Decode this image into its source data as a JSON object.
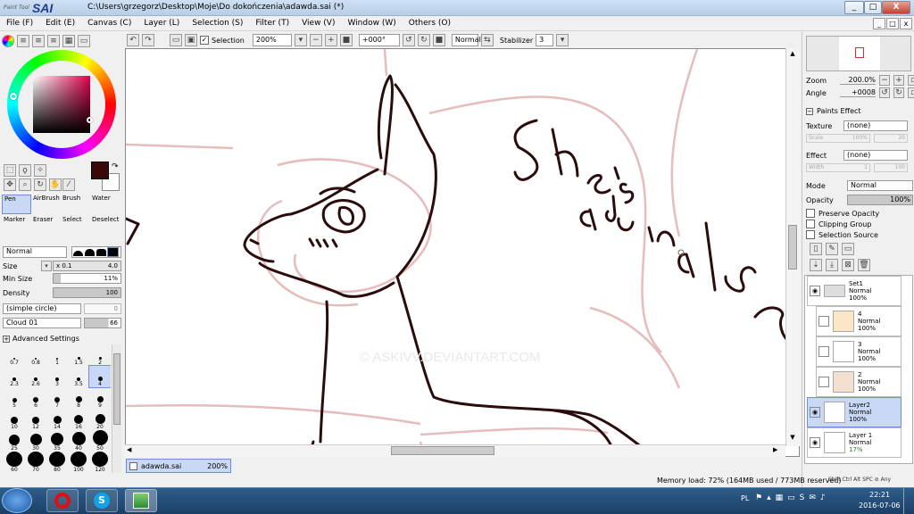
{
  "window": {
    "app_logo_small": "Paint Tool",
    "app_logo_big": "SAI",
    "title": "C:\\Users\\grzegorz\\Desktop\\Moje\\Do dokończenia\\adawda.sai (*)",
    "min": "_",
    "max": "□",
    "close": "X"
  },
  "menu": [
    "File (F)",
    "Edit (E)",
    "Canvas (C)",
    "Layer (L)",
    "Selection (S)",
    "Filter (T)",
    "View (V)",
    "Window (W)",
    "Others (O)"
  ],
  "toolbar": {
    "selection_label": "Selection",
    "zoom": "200%",
    "rotation": "+000°",
    "blend": "Normal",
    "stabilizer_label": "Stabilizer",
    "stabilizer": "3"
  },
  "tools": {
    "tabs": [
      "Pen",
      "AirBrush",
      "Brush",
      "Water",
      "Marker",
      "Eraser",
      "Select",
      "Deselect"
    ],
    "mode": "Normal",
    "size_label": "Size",
    "size_mult": "x 0.1",
    "size_value": "4.0",
    "minsize_label": "Min Size",
    "minsize_value": "11%",
    "density_label": "Density",
    "density_value": "100",
    "shape": "(simple circle)",
    "shape_value": "0",
    "texture": "Cloud 01",
    "texture_value": "66",
    "advanced": "Advanced Settings",
    "brush_sizes": [
      "0.7",
      "0.8",
      "1",
      "1.5",
      "2",
      "2.3",
      "2.6",
      "3",
      "3.5",
      "4",
      "5",
      "6",
      "7",
      "8",
      "9",
      "10",
      "12",
      "14",
      "16",
      "20",
      "25",
      "30",
      "35",
      "40",
      "50",
      "60",
      "70",
      "80",
      "100",
      "120"
    ]
  },
  "canvas": {
    "text_1": "She's",
    "text_2": "adonable",
    "watermark": "© ASKIVV.DEVIANTART.COM",
    "tab_name": "adawda.sai",
    "tab_zoom": "200%"
  },
  "navigator": {
    "zoom_label": "Zoom",
    "zoom_value": "200.0%",
    "angle_label": "Angle",
    "angle_value": "+0008"
  },
  "effects": {
    "title": "Paints Effect",
    "texture_label": "Texture",
    "texture_value": "(none)",
    "scale_label": "Scale",
    "scale_value": "100%",
    "scale_num": "20",
    "effect_label": "Effect",
    "effect_value": "(none)",
    "width_label": "Width",
    "width_value": "1",
    "width_num": "100"
  },
  "layer_props": {
    "mode_label": "Mode",
    "mode_value": "Normal",
    "opacity_label": "Opacity",
    "opacity_value": "100%",
    "preserve": "Preserve Opacity",
    "clipping": "Clipping Group",
    "selsource": "Selection Source"
  },
  "layers": [
    {
      "name": "Set1",
      "mode": "Normal",
      "opacity": "100%",
      "selected": false
    },
    {
      "name": "4",
      "mode": "Normal",
      "opacity": "100%",
      "selected": false
    },
    {
      "name": "3",
      "mode": "Normal",
      "opacity": "100%",
      "selected": false
    },
    {
      "name": "2",
      "mode": "Normal",
      "opacity": "100%",
      "selected": false
    },
    {
      "name": "Layer2",
      "mode": "Normal",
      "opacity": "100%",
      "selected": true
    },
    {
      "name": "Layer 1",
      "mode": "Normal",
      "opacity": "17%",
      "selected": false
    }
  ],
  "status": {
    "memory": "Memory load: 72% (164MB used / 773MB reserved)",
    "keys": "Shift Ctrl Alt SPC ⊘ Any"
  },
  "taskbar": {
    "lang": "PL",
    "time": "22:21",
    "date": "2016-07-06"
  },
  "colors": {
    "current_color": "#3a0808",
    "line_color": "#2b0c0c",
    "sketch_color": "#e6bcbc",
    "accent": "#6f8fd3"
  }
}
